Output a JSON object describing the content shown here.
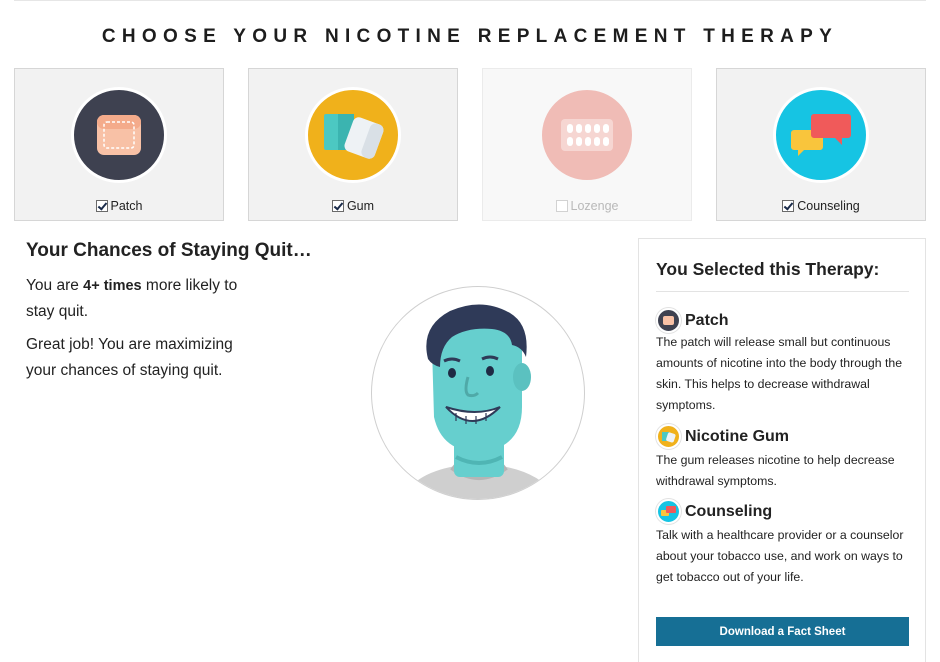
{
  "page": {
    "title": "CHOOSE YOUR NICOTINE REPLACEMENT THERAPY"
  },
  "therapies": [
    {
      "label": "Patch",
      "checked": true,
      "enabled": true,
      "icon": "patch-icon",
      "circle_color": "#3e4150"
    },
    {
      "label": "Gum",
      "checked": true,
      "enabled": true,
      "icon": "gum-icon",
      "circle_color": "#f0b11b"
    },
    {
      "label": "Lozenge",
      "checked": false,
      "enabled": false,
      "icon": "lozenge-icon",
      "circle_color": "#f0bcb6"
    },
    {
      "label": "Counseling",
      "checked": true,
      "enabled": true,
      "icon": "counseling-icon",
      "circle_color": "#16c4e3"
    }
  ],
  "chances": {
    "title": "Your Chances of Staying Quit…",
    "line_prefix": "You are ",
    "multiplier": "4+ times",
    "line_suffix": " more likely to stay quit.",
    "encouragement": "Great job! You are maximizing your chances of staying quit."
  },
  "selected_panel": {
    "title": "You Selected this Therapy:",
    "items": [
      {
        "name": "Patch",
        "icon": "patch-icon",
        "description": "The patch will release small but continuous amounts of nicotine into the body through the skin. This helps to decrease withdrawal symptoms."
      },
      {
        "name": "Nicotine Gum",
        "icon": "gum-icon",
        "description": "The gum releases nicotine to help decrease withdrawal symptoms."
      },
      {
        "name": "Counseling",
        "icon": "counseling-icon",
        "description": "Talk with a healthcare provider or a counselor about your tobacco use, and work on ways to get tobacco out of your life."
      }
    ],
    "download_label": "Download a Fact Sheet"
  },
  "colors": {
    "accent": "#166f95",
    "avatar_skin": "#66cfce",
    "avatar_hair": "#2f3a58"
  }
}
